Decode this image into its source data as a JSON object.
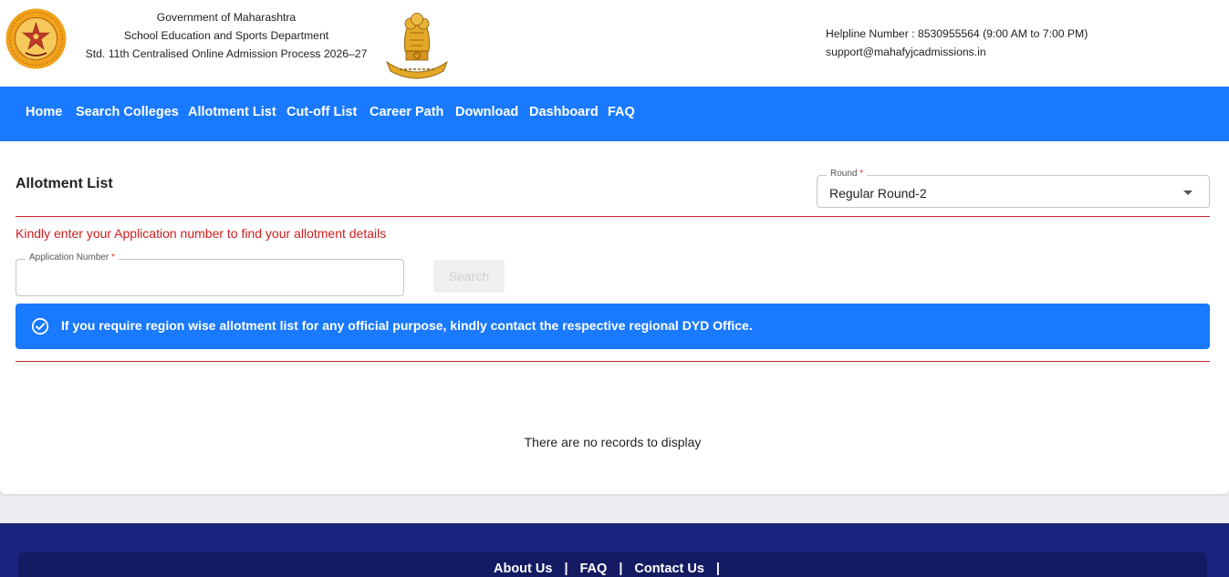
{
  "header": {
    "gov_line1": "Government of Maharashtra",
    "gov_line2": "School Education and Sports Department",
    "gov_line3": "Std. 11th Centralised Online Admission Process 2026–27",
    "helpline": "Helpline Number : 8530955564 (9:00 AM to 7:00 PM)",
    "email": "support@mahafyjcadmissions.in",
    "emblem_icon": "national-emblem-icon",
    "seal_icon": "maharashtra-seal-icon"
  },
  "nav": {
    "items": [
      {
        "label": "Home"
      },
      {
        "label": "Search Colleges"
      },
      {
        "label": "Allotment List"
      },
      {
        "label": "Cut-off List"
      },
      {
        "label": "Career Path"
      },
      {
        "label": "Download"
      },
      {
        "label": "Dashboard"
      },
      {
        "label": "FAQ"
      }
    ]
  },
  "page": {
    "title": "Allotment List",
    "round_label": "Round",
    "round_required": "*",
    "round_value": "Regular Round-2",
    "hint": "Kindly enter your Application number to find your allotment details",
    "app_label": "Application Number",
    "app_required": "*",
    "app_value": "",
    "search_label": "Search",
    "info_text": "If you require region wise allotment list for any official purpose, kindly contact the respective regional DYD Office.",
    "no_records": "There are no records to display"
  },
  "footer": {
    "links": [
      {
        "label": "About Us"
      },
      {
        "label": "FAQ"
      },
      {
        "label": "Contact Us"
      }
    ],
    "separator": "|"
  },
  "colors": {
    "primary": "#1979ff",
    "divider": "#c0282d",
    "hint": "#d01c1c",
    "footer": "#1a237e"
  }
}
